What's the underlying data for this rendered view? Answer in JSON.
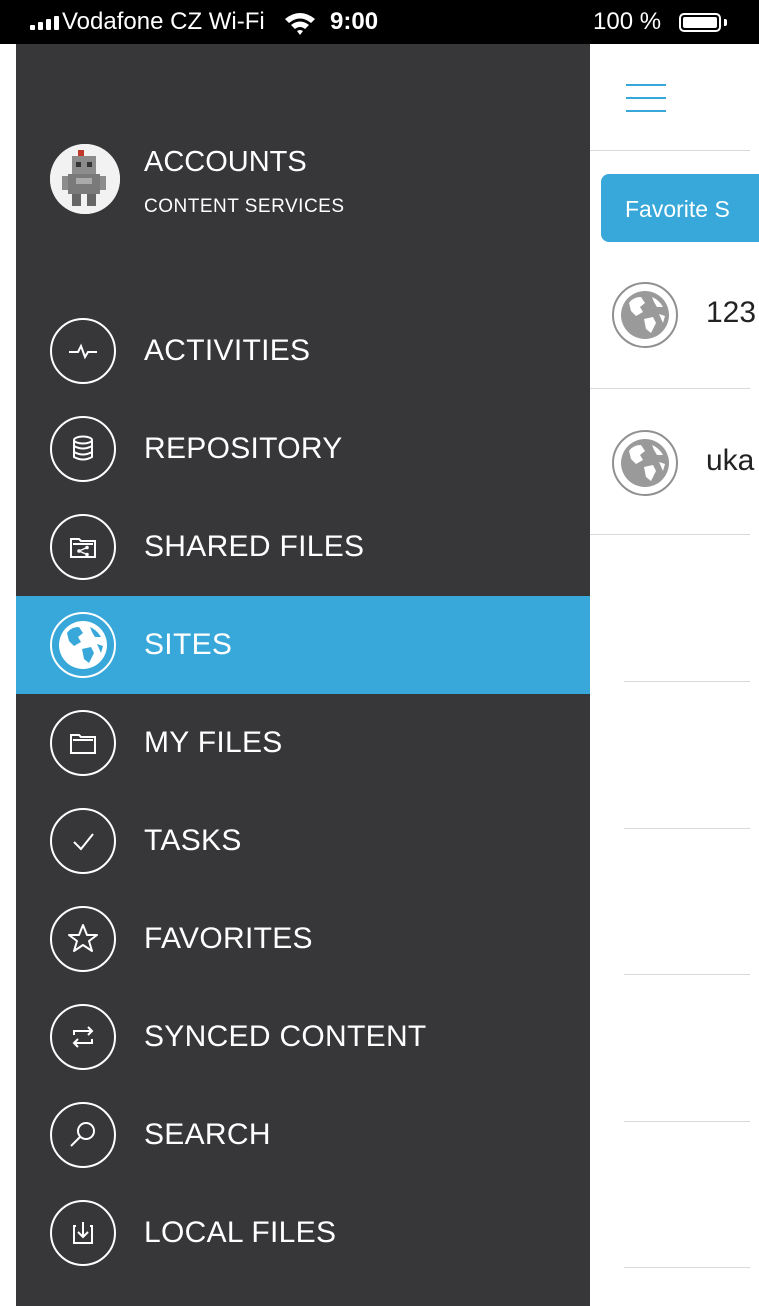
{
  "status_bar": {
    "carrier": "Vodafone CZ Wi-Fi",
    "time": "9:00",
    "battery": "100 %",
    "icons": [
      "signal-bars-icon",
      "wifi-icon",
      "battery-icon"
    ]
  },
  "drawer": {
    "account": {
      "name": "ACCOUNTS",
      "subtitle": "CONTENT SERVICES",
      "avatar_icon": "robot-knight-avatar"
    },
    "items": [
      {
        "label": "ACTIVITIES",
        "icon": "activity-pulse-icon",
        "active": false
      },
      {
        "label": "REPOSITORY",
        "icon": "database-icon",
        "active": false
      },
      {
        "label": "SHARED FILES",
        "icon": "shared-folder-icon",
        "active": false
      },
      {
        "label": "SITES",
        "icon": "globe-icon",
        "active": true
      },
      {
        "label": "MY FILES",
        "icon": "folder-icon",
        "active": false
      },
      {
        "label": "TASKS",
        "icon": "checkmark-icon",
        "active": false
      },
      {
        "label": "FAVORITES",
        "icon": "star-icon",
        "active": false
      },
      {
        "label": "SYNCED CONTENT",
        "icon": "sync-arrows-icon",
        "active": false
      },
      {
        "label": "SEARCH",
        "icon": "search-icon",
        "active": false
      },
      {
        "label": "LOCAL FILES",
        "icon": "download-icon",
        "active": false
      }
    ]
  },
  "content": {
    "menu_icon": "hamburger-menu-icon",
    "tab_label": "Favorite S",
    "sites": [
      {
        "title": "123",
        "icon": "globe-icon"
      },
      {
        "title": "uka",
        "icon": "globe-icon"
      }
    ]
  },
  "colors": {
    "drawer_bg": "#37373a",
    "accent": "#37a8d9",
    "status_bar_bg": "#000000"
  }
}
